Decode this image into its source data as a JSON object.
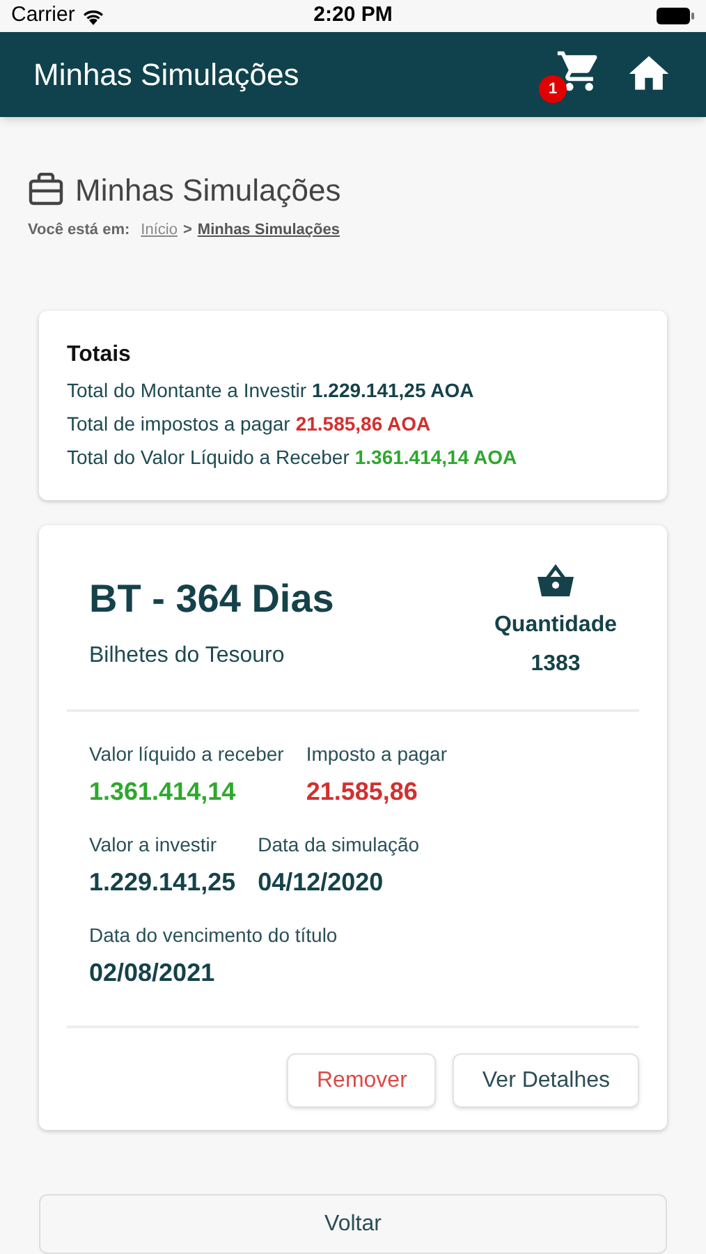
{
  "status_bar": {
    "carrier": "Carrier",
    "time": "2:20 PM"
  },
  "header": {
    "title": "Minhas Simulações",
    "cart_badge": "1"
  },
  "page": {
    "title": "Minhas Simulações",
    "breadcrumb": {
      "prefix": "Você está em:",
      "items": [
        {
          "label": "Início",
          "current": false
        },
        {
          "label": "Minhas Simulações",
          "current": true
        }
      ],
      "separator": ">"
    }
  },
  "totals": {
    "title": "Totais",
    "lines": [
      {
        "label": "Total do Montante a Investir",
        "value": "1.229.141,25 AOA",
        "color": "#15424a"
      },
      {
        "label": "Total de impostos a pagar",
        "value": "21.585,86 AOA",
        "color": "#d32f2f"
      },
      {
        "label": "Total do Valor Líquido a Receber",
        "value": "1.361.414,14 AOA",
        "color": "#2ea82e"
      }
    ]
  },
  "simulation": {
    "title": "BT - 364 Dias",
    "subtitle": "Bilhetes do Tesouro",
    "quantity_label": "Quantidade",
    "quantity": "1383",
    "field_rows": [
      [
        {
          "label": "Valor líquido a receber",
          "value": "1.361.414,14",
          "color": "#2ea82e"
        },
        {
          "label": "Imposto a pagar",
          "value": "21.585,86",
          "color": "#d32f2f"
        }
      ],
      [
        {
          "label": "Valor a investir",
          "value": "1.229.141,25",
          "color": "#15424a"
        },
        {
          "label": "Data da simulação",
          "value": "04/12/2020",
          "color": "#15424a"
        }
      ],
      [
        {
          "label": "Data do vencimento do título",
          "value": "02/08/2021",
          "color": "#15424a"
        }
      ]
    ],
    "buttons": [
      {
        "label": "Remover",
        "kind": "danger"
      },
      {
        "label": "Ver Detalhes",
        "kind": "default"
      }
    ]
  },
  "back_button": "Voltar"
}
